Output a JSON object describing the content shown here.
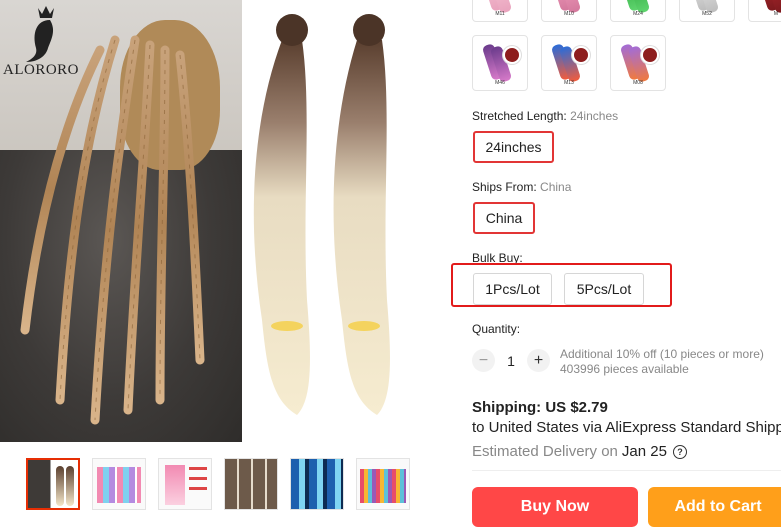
{
  "brand": {
    "logo_text": "ALORORO"
  },
  "colors": {
    "accent": "#ff4747",
    "cart": "#ff9f1a",
    "selected_border": "#e23535",
    "highlight": "#e21b1b"
  },
  "swatches_top": [
    {
      "code": "M11",
      "color_a": "#f7c6d6",
      "color_b": "#e9a3bd"
    },
    {
      "code": "M10",
      "color_a": "#f3a0c0",
      "color_b": "#d4799d"
    },
    {
      "code": "M24",
      "color_a": "#2aa43a",
      "color_b": "#5fd46e"
    },
    {
      "code": "M52",
      "color_a": "#e8e8e8",
      "color_b": "#bdbdbd"
    },
    {
      "code": "M",
      "color_a": "#b0272e",
      "color_b": "#7d1a1e"
    }
  ],
  "swatches_row": [
    {
      "code": "M46",
      "color_a": "#6b3b8c",
      "color_b": "#d77ac9"
    },
    {
      "code": "M13",
      "color_a": "#2b6cd8",
      "color_b": "#f25c3c"
    },
    {
      "code": "M08",
      "color_a": "#a36cd6",
      "color_b": "#f07a3f"
    }
  ],
  "stretched_length": {
    "label": "Stretched Length:",
    "value": "24inches",
    "options": [
      "24inches"
    ]
  },
  "ships_from": {
    "label": "Ships From:",
    "value": "China",
    "options": [
      "China"
    ]
  },
  "bulk_buy": {
    "label": "Bulk Buy:",
    "options": [
      "1Pcs/Lot",
      "5Pcs/Lot"
    ]
  },
  "quantity": {
    "label": "Quantity:",
    "minus": "−",
    "plus": "+",
    "value": "1",
    "discount_note": "Additional 10% off (10 pieces or more)",
    "available": "403996 pieces available"
  },
  "shipping": {
    "title": "Shipping: US $2.79",
    "line": "to United States via AliExpress Standard Shipping",
    "delivery_label": "Estimated Delivery on",
    "delivery_date": "Jan 25",
    "help_glyph": "?"
  },
  "actions": {
    "buy_now": "Buy Now",
    "add_to_cart": "Add to Cart"
  },
  "thumbnails": [
    {
      "name": "main"
    },
    {
      "name": "colors-chart"
    },
    {
      "name": "features"
    },
    {
      "name": "styles"
    },
    {
      "name": "blue-braids"
    },
    {
      "name": "color-palette"
    }
  ]
}
